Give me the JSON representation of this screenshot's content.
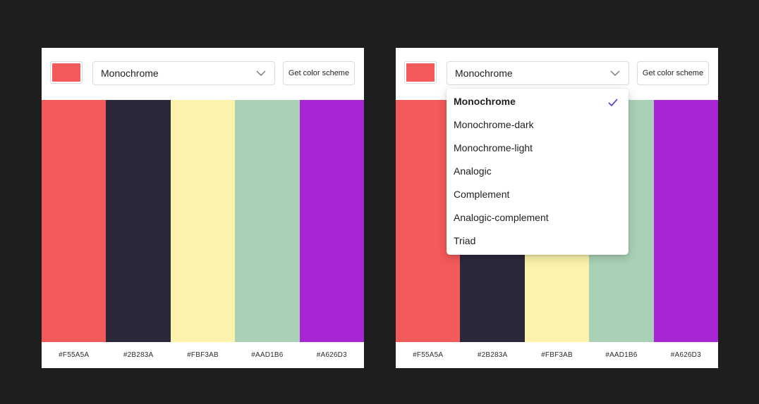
{
  "colors": {
    "background": "#1e1e1e",
    "seed": "#F55A5A",
    "check_accent": "#5b4cc4"
  },
  "panels": [
    {
      "seed_color": "#F55A5A",
      "mode_value": "Monochrome",
      "button_label": "Get color scheme",
      "palette": [
        "#F55A5A",
        "#2B283A",
        "#FBF3AB",
        "#AAD1B6",
        "#A626D3"
      ],
      "hex_labels": [
        "#F55A5A",
        "#2B283A",
        "#FBF3AB",
        "#AAD1B6",
        "#A626D3"
      ],
      "icons": {
        "select": "chevron-down-icon"
      }
    },
    {
      "seed_color": "#F55A5A",
      "mode_value": "Monochrome",
      "button_label": "Get color scheme",
      "palette": [
        "#F55A5A",
        "#2B283A",
        "#FBF3AB",
        "#AAD1B6",
        "#A626D3"
      ],
      "hex_labels": [
        "#F55A5A",
        "#2B283A",
        "#FBF3AB",
        "#AAD1B6",
        "#A626D3"
      ],
      "icons": {
        "select": "chevron-down-icon",
        "selected": "check-icon"
      },
      "dropdown": {
        "open": true,
        "selected_index": 0,
        "options": [
          "Monochrome",
          "Monochrome-dark",
          "Monochrome-light",
          "Analogic",
          "Complement",
          "Analogic-complement",
          "Triad"
        ]
      }
    }
  ]
}
